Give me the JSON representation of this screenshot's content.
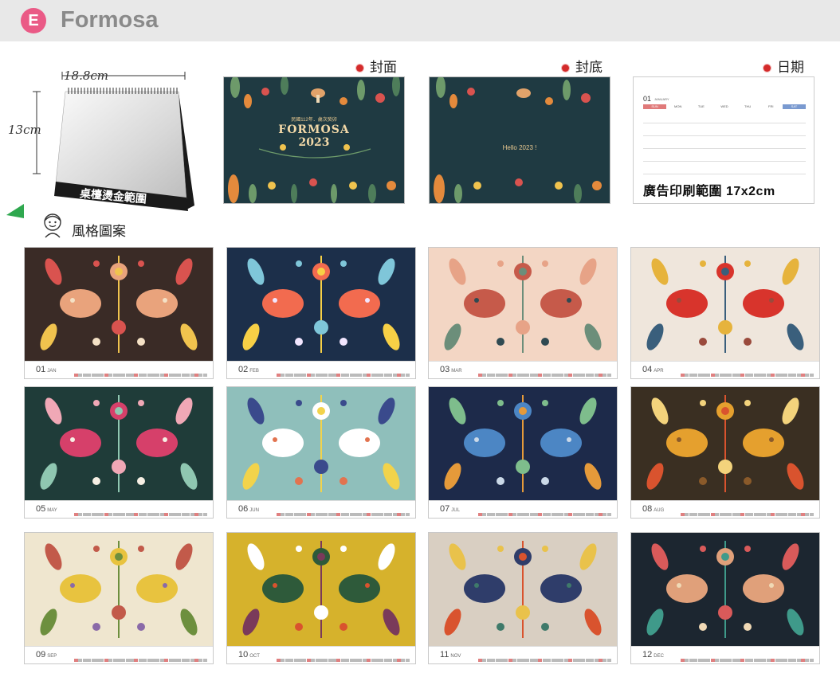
{
  "header": {
    "badge": "E",
    "title": "Formosa"
  },
  "product": {
    "width_label": "18.8cm",
    "height_label": "13cm",
    "foil_label": "桌檯燙金範圍"
  },
  "previews": {
    "front": {
      "label": "封面",
      "sub": "民國112年．歲次癸卯",
      "title_top": "FORMOSA",
      "title_bottom": "2023"
    },
    "back": {
      "label": "封底",
      "text": "Hello 2023 !"
    },
    "date": {
      "label": "日期",
      "month": "01",
      "month_name": "JANUARY",
      "weekdays": [
        "SUN",
        "MON",
        "TUE",
        "WED",
        "THU",
        "FRI",
        "SAT"
      ],
      "ad_text": "廣告印刷範圍 17x2cm"
    }
  },
  "styles_label": "風格圖案",
  "months": [
    {
      "num": "01",
      "name": "JAN",
      "bg": "#3a2b26",
      "accents": [
        "#e9a37c",
        "#f0c34e",
        "#d9534f",
        "#f4e1c5"
      ]
    },
    {
      "num": "02",
      "name": "FEB",
      "bg": "#1c2f4a",
      "accents": [
        "#f26b4f",
        "#f7d046",
        "#7fc6d9",
        "#f2e6ff"
      ]
    },
    {
      "num": "03",
      "name": "MAR",
      "bg": "#f3d6c4",
      "accents": [
        "#c65a4a",
        "#6c8e7a",
        "#e7a387",
        "#2f4a52"
      ]
    },
    {
      "num": "04",
      "name": "APR",
      "bg": "#efe6dc",
      "accents": [
        "#d8342c",
        "#3a5f7c",
        "#e6b33c",
        "#9a4a3c"
      ]
    },
    {
      "num": "05",
      "name": "MAY",
      "bg": "#1f3c39",
      "accents": [
        "#d6406a",
        "#8fc7b1",
        "#f0a8b6",
        "#f6efe4"
      ]
    },
    {
      "num": "06",
      "name": "JUN",
      "bg": "#8fbfbb",
      "accents": [
        "#ffffff",
        "#f2d34b",
        "#3a4a8c",
        "#e2734f"
      ]
    },
    {
      "num": "07",
      "name": "JUL",
      "bg": "#1d2a4a",
      "accents": [
        "#4c86c4",
        "#e59a3a",
        "#7ebd8c",
        "#cbd9e8"
      ]
    },
    {
      "num": "08",
      "name": "AUG",
      "bg": "#3a2f22",
      "accents": [
        "#e5a02e",
        "#d9532e",
        "#f3d37c",
        "#8a5a2a"
      ]
    },
    {
      "num": "09",
      "name": "SEP",
      "bg": "#efe6cf",
      "accents": [
        "#e8c33f",
        "#6d8f3e",
        "#c25a4a",
        "#8a6aa8"
      ]
    },
    {
      "num": "10",
      "name": "OCT",
      "bg": "#d6b22c",
      "accents": [
        "#2e5a3a",
        "#7a3a5a",
        "#ffffff",
        "#d9532e"
      ]
    },
    {
      "num": "11",
      "name": "NOV",
      "bg": "#d9cfc2",
      "accents": [
        "#2f3d6a",
        "#d9532e",
        "#e9c24b",
        "#3f7a6a"
      ]
    },
    {
      "num": "12",
      "name": "DEC",
      "bg": "#1c2630",
      "accents": [
        "#e0a07a",
        "#3f9a8a",
        "#d95a5a",
        "#f0d9b5"
      ]
    }
  ]
}
